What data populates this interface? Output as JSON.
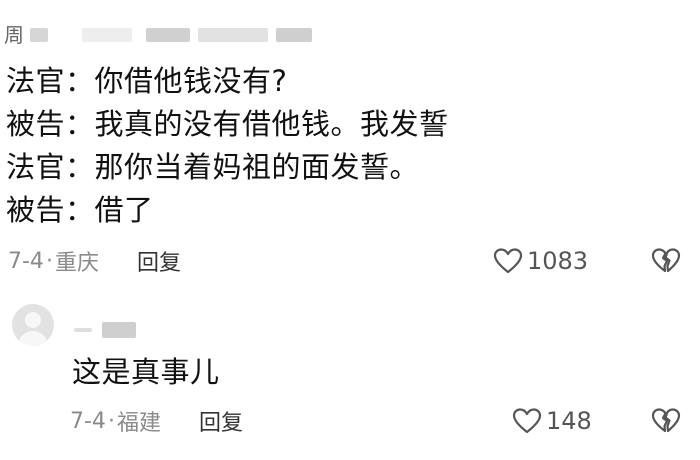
{
  "comments": [
    {
      "username_visible": "周",
      "lines": [
        "法官：你借他钱没有?",
        "被告：我真的没有借他钱。我发誓",
        "法官：那你当着妈祖的面发誓。",
        "被告：借了"
      ],
      "date": "7-4",
      "separator": "·",
      "location": "重庆",
      "reply_label": "回复",
      "like_count": "1083"
    },
    {
      "lines": [
        "这是真事儿"
      ],
      "date": "7-4",
      "separator": "·",
      "location": "福建",
      "reply_label": "回复",
      "like_count": "148"
    }
  ],
  "icons": {
    "like": "heart-outline-icon",
    "dislike": "broken-heart-icon",
    "avatar": "default-avatar-icon"
  },
  "colors": {
    "text": "#111111",
    "meta": "#8a8a8a",
    "reply": "#333333",
    "icon": "#555555"
  }
}
